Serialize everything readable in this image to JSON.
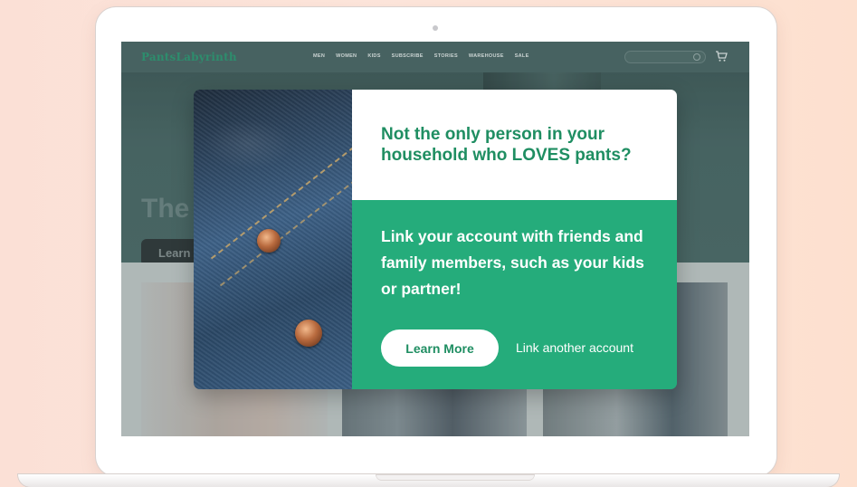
{
  "site": {
    "logo": "PantsLabyrinth",
    "nav": [
      "MEN",
      "WOMEN",
      "KIDS",
      "SUBSCRIBE",
      "STORIES",
      "WAREHOUSE",
      "SALE"
    ],
    "hero_title": "The",
    "hero_button": "Learn"
  },
  "modal": {
    "headline": "Not the only person in your household who LOVES pants?",
    "body": "Link your account with friends and family members, such as your kids or partner!",
    "primary_button": "Learn More",
    "secondary_link": "Link another account"
  },
  "colors": {
    "brand_green": "#25ac7b",
    "headline_green": "#1f8e62",
    "background_peach": "#fde3d8"
  },
  "icons": [
    "cart-icon",
    "search-icon"
  ]
}
